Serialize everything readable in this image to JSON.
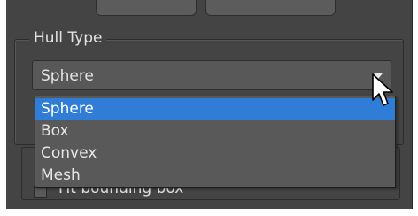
{
  "hull_group": {
    "title": "Hull Type",
    "combo_value": "Sphere",
    "options": [
      {
        "label": "Sphere",
        "selected": true
      },
      {
        "label": "Box",
        "selected": false
      },
      {
        "label": "Convex",
        "selected": false
      },
      {
        "label": "Mesh",
        "selected": false
      }
    ]
  },
  "fit_option": {
    "label": "Fit bounding box"
  },
  "icons": {
    "combo_arrow": "chevron-down-icon",
    "pointer": "mouse-pointer-icon"
  },
  "colors": {
    "panel": "#444444",
    "selection": "#2f7dd6",
    "text": "#e4e4e4"
  }
}
